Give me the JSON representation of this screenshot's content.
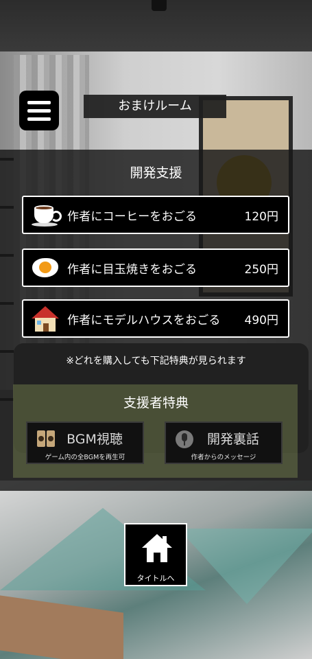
{
  "header": {
    "title": "おまけルーム",
    "menu_icon": "hamburger-menu-icon"
  },
  "development_support": {
    "title": "開発支援",
    "items": [
      {
        "icon": "coffee-cup-icon",
        "label": "作者にコーヒーをおごる",
        "price": "120円"
      },
      {
        "icon": "fried-egg-icon",
        "label": "作者に目玉焼きをおごる",
        "price": "250円"
      },
      {
        "icon": "house-icon",
        "label": "作者にモデルハウスをおごる",
        "price": "490円"
      }
    ],
    "note": "※どれを購入しても下記特典が見られます"
  },
  "supporter_bonus": {
    "title": "支援者特典",
    "bgm": {
      "icon": "speaker-icon",
      "label": "BGM視聴",
      "sub": "ゲーム内の全BGMを再生可"
    },
    "talk": {
      "icon": "microphone-icon",
      "label": "開発裏話",
      "sub": "作者からのメッセージ"
    }
  },
  "footer": {
    "home_icon": "home-icon",
    "home_label": "タイトルへ"
  },
  "colors": {
    "button_bg": "#000000",
    "button_border": "#ffffff",
    "bonus_panel": "#6c7648"
  }
}
